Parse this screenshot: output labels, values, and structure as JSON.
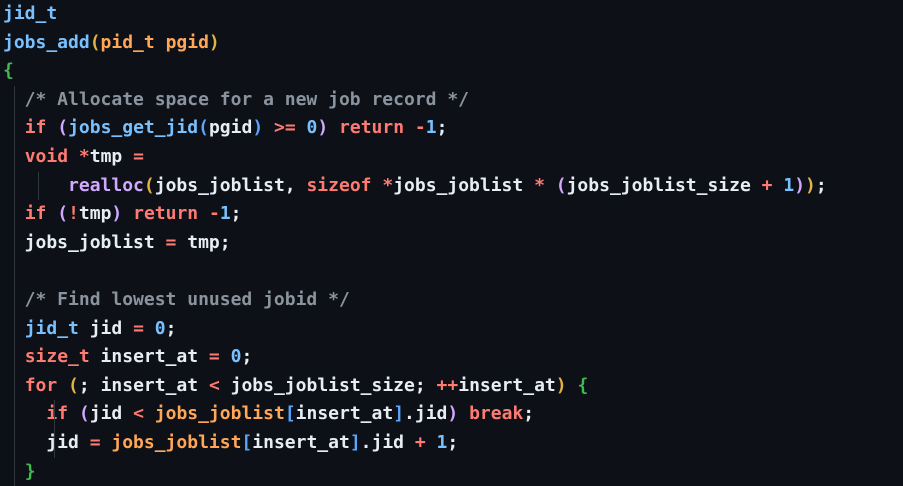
{
  "colors": {
    "background": "#0d1117",
    "default_text": "#e6edf3",
    "keyword": "#ff7b72",
    "type": "#79c0ff",
    "function": "#d2a8ff",
    "number": "#79c0ff",
    "comment": "#8b949e",
    "variable": "#ffa657",
    "bracket_yellow": "#e3b341",
    "bracket_pink": "#d2a8ff",
    "bracket_blue": "#58a6ff",
    "bracket_green": "#3fb950"
  },
  "code_lines": [
    {
      "guides": [],
      "tokens": [
        {
          "t": "jid_t",
          "c": "#79c0ff"
        }
      ]
    },
    {
      "guides": [],
      "tokens": [
        {
          "t": "jobs_add",
          "c": "#79c0ff"
        },
        {
          "t": "(",
          "c": "#e3b341"
        },
        {
          "t": "pid_t",
          "c": "#ffa657"
        },
        {
          "t": " pgid",
          "c": "#ffa657"
        },
        {
          "t": ")",
          "c": "#e3b341"
        }
      ]
    },
    {
      "guides": [],
      "tokens": [
        {
          "t": "{",
          "c": "#3fb950"
        }
      ]
    },
    {
      "guides": [
        "g1"
      ],
      "tokens": [
        {
          "t": "  /* Allocate space for a new job record */",
          "c": "#8b949e"
        }
      ]
    },
    {
      "guides": [
        "g1"
      ],
      "tokens": [
        {
          "t": "  ",
          "c": "#e6edf3"
        },
        {
          "t": "if",
          "c": "#ff7b72"
        },
        {
          "t": " ",
          "c": "#e6edf3"
        },
        {
          "t": "(",
          "c": "#d2a8ff"
        },
        {
          "t": "jobs_get_jid",
          "c": "#79c0ff"
        },
        {
          "t": "(",
          "c": "#58a6ff"
        },
        {
          "t": "pgid",
          "c": "#e6edf3"
        },
        {
          "t": ")",
          "c": "#58a6ff"
        },
        {
          "t": " >= ",
          "c": "#ff7b72"
        },
        {
          "t": "0",
          "c": "#79c0ff"
        },
        {
          "t": ")",
          "c": "#d2a8ff"
        },
        {
          "t": " ",
          "c": "#e6edf3"
        },
        {
          "t": "return",
          "c": "#ff7b72"
        },
        {
          "t": " -",
          "c": "#ff7b72"
        },
        {
          "t": "1",
          "c": "#79c0ff"
        },
        {
          "t": ";",
          "c": "#e6edf3"
        }
      ]
    },
    {
      "guides": [
        "g1"
      ],
      "tokens": [
        {
          "t": "  ",
          "c": "#e6edf3"
        },
        {
          "t": "void",
          "c": "#ff7b72"
        },
        {
          "t": " *",
          "c": "#ff7b72"
        },
        {
          "t": "tmp",
          "c": "#e6edf3"
        },
        {
          "t": " =",
          "c": "#ff7b72"
        }
      ]
    },
    {
      "guides": [
        "g1",
        "g2"
      ],
      "tokens": [
        {
          "t": "      ",
          "c": "#e6edf3"
        },
        {
          "t": "realloc",
          "c": "#d2a8ff"
        },
        {
          "t": "(",
          "c": "#e3b341"
        },
        {
          "t": "jobs_joblist",
          "c": "#e6edf3"
        },
        {
          "t": ", ",
          "c": "#e6edf3"
        },
        {
          "t": "sizeof",
          "c": "#ff7b72"
        },
        {
          "t": " *",
          "c": "#ff7b72"
        },
        {
          "t": "jobs_joblist",
          "c": "#e6edf3"
        },
        {
          "t": " * ",
          "c": "#ff7b72"
        },
        {
          "t": "(",
          "c": "#d2a8ff"
        },
        {
          "t": "jobs_joblist_size",
          "c": "#e6edf3"
        },
        {
          "t": " + ",
          "c": "#ff7b72"
        },
        {
          "t": "1",
          "c": "#79c0ff"
        },
        {
          "t": ")",
          "c": "#d2a8ff"
        },
        {
          "t": ")",
          "c": "#e3b341"
        },
        {
          "t": ";",
          "c": "#e6edf3"
        }
      ]
    },
    {
      "guides": [
        "g1"
      ],
      "tokens": [
        {
          "t": "  ",
          "c": "#e6edf3"
        },
        {
          "t": "if",
          "c": "#ff7b72"
        },
        {
          "t": " ",
          "c": "#e6edf3"
        },
        {
          "t": "(",
          "c": "#d2a8ff"
        },
        {
          "t": "!",
          "c": "#ff7b72"
        },
        {
          "t": "tmp",
          "c": "#e6edf3"
        },
        {
          "t": ")",
          "c": "#d2a8ff"
        },
        {
          "t": " ",
          "c": "#e6edf3"
        },
        {
          "t": "return",
          "c": "#ff7b72"
        },
        {
          "t": " -",
          "c": "#ff7b72"
        },
        {
          "t": "1",
          "c": "#79c0ff"
        },
        {
          "t": ";",
          "c": "#e6edf3"
        }
      ]
    },
    {
      "guides": [
        "g1"
      ],
      "tokens": [
        {
          "t": "  jobs_joblist",
          "c": "#e6edf3"
        },
        {
          "t": " = ",
          "c": "#ff7b72"
        },
        {
          "t": "tmp",
          "c": "#e6edf3"
        },
        {
          "t": ";",
          "c": "#e6edf3"
        }
      ]
    },
    {
      "guides": [
        "g1"
      ],
      "tokens": [
        {
          "t": " ",
          "c": "#e6edf3"
        }
      ]
    },
    {
      "guides": [
        "g1"
      ],
      "tokens": [
        {
          "t": "  /* Find lowest unused jobid */",
          "c": "#8b949e"
        }
      ]
    },
    {
      "guides": [
        "g1"
      ],
      "tokens": [
        {
          "t": "  ",
          "c": "#e6edf3"
        },
        {
          "t": "jid_t",
          "c": "#79c0ff"
        },
        {
          "t": " jid",
          "c": "#e6edf3"
        },
        {
          "t": " = ",
          "c": "#ff7b72"
        },
        {
          "t": "0",
          "c": "#79c0ff"
        },
        {
          "t": ";",
          "c": "#e6edf3"
        }
      ]
    },
    {
      "guides": [
        "g1"
      ],
      "tokens": [
        {
          "t": "  ",
          "c": "#e6edf3"
        },
        {
          "t": "size_t",
          "c": "#ff7b72"
        },
        {
          "t": " insert_at",
          "c": "#e6edf3"
        },
        {
          "t": " = ",
          "c": "#ff7b72"
        },
        {
          "t": "0",
          "c": "#79c0ff"
        },
        {
          "t": ";",
          "c": "#e6edf3"
        }
      ]
    },
    {
      "guides": [
        "g1"
      ],
      "tokens": [
        {
          "t": "  ",
          "c": "#e6edf3"
        },
        {
          "t": "for",
          "c": "#ff7b72"
        },
        {
          "t": " ",
          "c": "#e6edf3"
        },
        {
          "t": "(",
          "c": "#e3b341"
        },
        {
          "t": "; insert_at",
          "c": "#e6edf3"
        },
        {
          "t": " < ",
          "c": "#ff7b72"
        },
        {
          "t": "jobs_joblist_size",
          "c": "#e6edf3"
        },
        {
          "t": "; ",
          "c": "#e6edf3"
        },
        {
          "t": "++",
          "c": "#ff7b72"
        },
        {
          "t": "insert_at",
          "c": "#e6edf3"
        },
        {
          "t": ")",
          "c": "#e3b341"
        },
        {
          "t": " ",
          "c": "#e6edf3"
        },
        {
          "t": "{",
          "c": "#3fb950"
        }
      ]
    },
    {
      "guides": [
        "g1",
        "g3"
      ],
      "tokens": [
        {
          "t": "    ",
          "c": "#e6edf3"
        },
        {
          "t": "if",
          "c": "#ff7b72"
        },
        {
          "t": " ",
          "c": "#e6edf3"
        },
        {
          "t": "(",
          "c": "#d2a8ff"
        },
        {
          "t": "jid",
          "c": "#e6edf3"
        },
        {
          "t": " < ",
          "c": "#ff7b72"
        },
        {
          "t": "jobs_joblist",
          "c": "#ffa657"
        },
        {
          "t": "[",
          "c": "#58a6ff"
        },
        {
          "t": "insert_at",
          "c": "#e6edf3"
        },
        {
          "t": "]",
          "c": "#58a6ff"
        },
        {
          "t": ".jid",
          "c": "#e6edf3"
        },
        {
          "t": ")",
          "c": "#d2a8ff"
        },
        {
          "t": " ",
          "c": "#e6edf3"
        },
        {
          "t": "break",
          "c": "#ff7b72"
        },
        {
          "t": ";",
          "c": "#e6edf3"
        }
      ]
    },
    {
      "guides": [
        "g1",
        "g3"
      ],
      "tokens": [
        {
          "t": "    jid",
          "c": "#e6edf3"
        },
        {
          "t": " = ",
          "c": "#ff7b72"
        },
        {
          "t": "jobs_joblist",
          "c": "#ffa657"
        },
        {
          "t": "[",
          "c": "#58a6ff"
        },
        {
          "t": "insert_at",
          "c": "#e6edf3"
        },
        {
          "t": "]",
          "c": "#58a6ff"
        },
        {
          "t": ".jid",
          "c": "#e6edf3"
        },
        {
          "t": " + ",
          "c": "#ff7b72"
        },
        {
          "t": "1",
          "c": "#79c0ff"
        },
        {
          "t": ";",
          "c": "#e6edf3"
        }
      ]
    },
    {
      "guides": [
        "g1"
      ],
      "tokens": [
        {
          "t": "  ",
          "c": "#e6edf3"
        },
        {
          "t": "}",
          "c": "#3fb950"
        }
      ]
    }
  ]
}
